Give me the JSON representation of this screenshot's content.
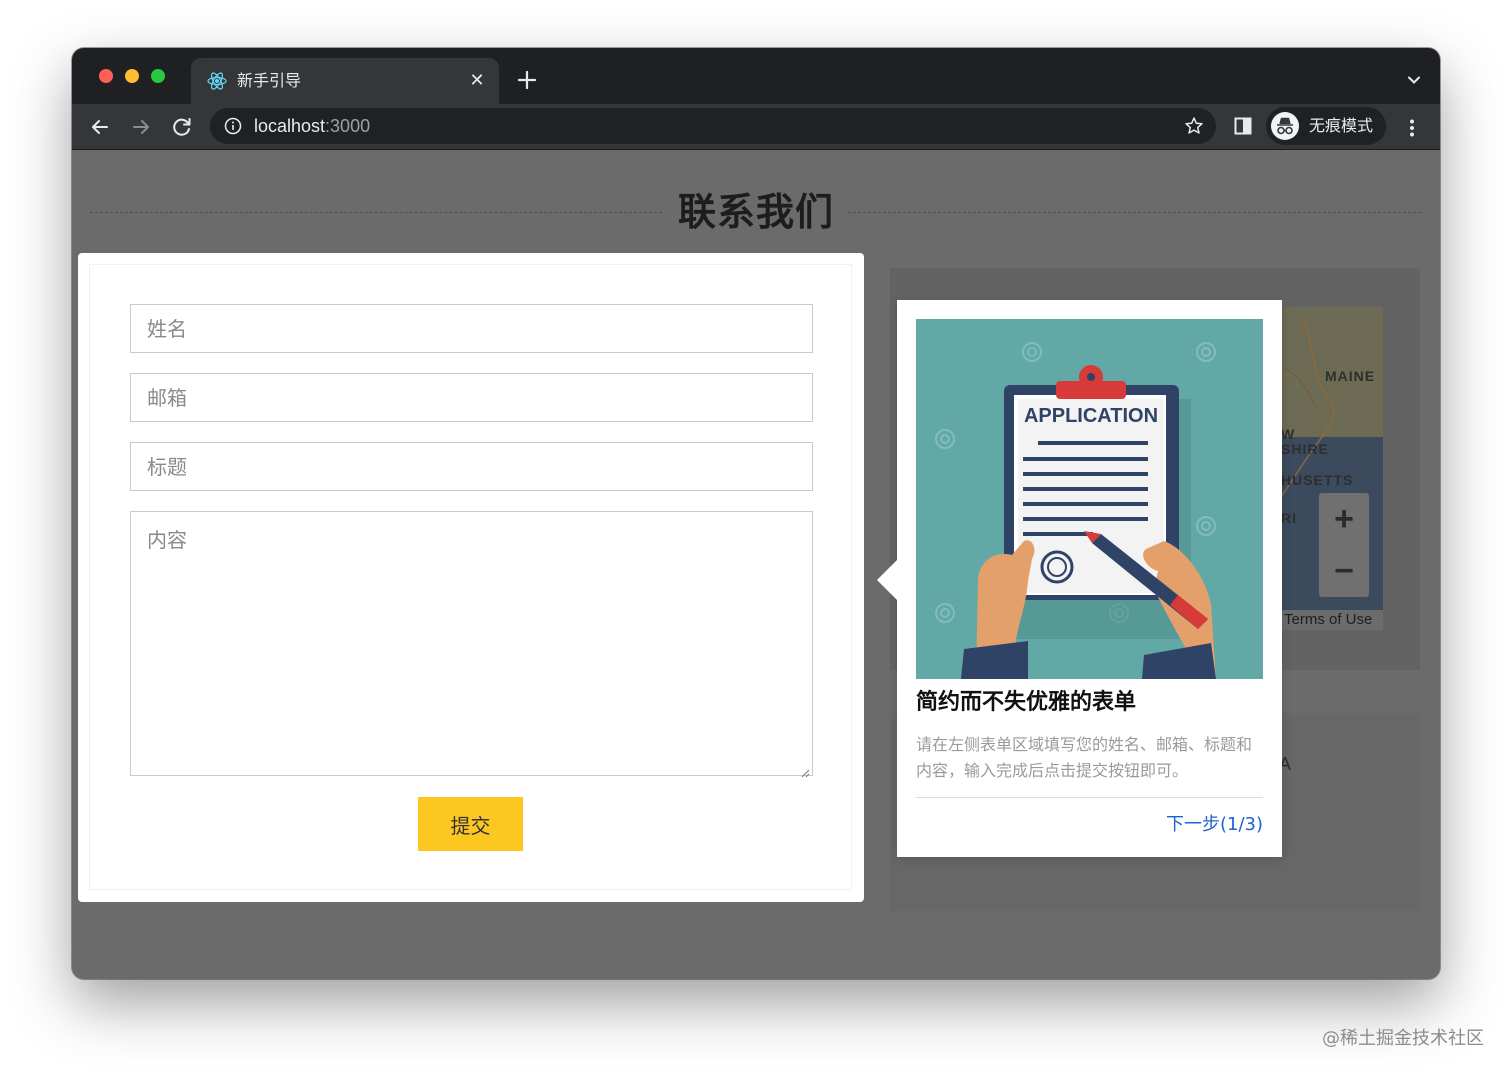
{
  "browser": {
    "tab_title": "新手引导",
    "tab_close": "✕",
    "url_host": "localhost",
    "url_port": ":3000",
    "profile_label": "无痕模式"
  },
  "page": {
    "section_title": "联系我们"
  },
  "form": {
    "name_placeholder": "姓名",
    "email_placeholder": "邮箱",
    "subject_placeholder": "标题",
    "content_placeholder": "内容",
    "submit_label": "提交"
  },
  "map": {
    "labels": [
      "MAINE",
      "W",
      "SHIRE",
      "HUSETTS",
      "RI"
    ],
    "zoom_in": "+",
    "zoom_out": "−",
    "terms": "Terms of Use",
    "stray_letter": "A"
  },
  "guide": {
    "image_text": "APPLICATION",
    "title": "简约而不失优雅的表单",
    "description": "请在左侧表单区域填写您的姓名、邮箱、标题和内容，输入完成后点击提交按钮即可。",
    "next_label": "下一步(1/3)",
    "step_current": 1,
    "step_total": 3
  },
  "watermark": "@稀土掘金技术社区"
}
